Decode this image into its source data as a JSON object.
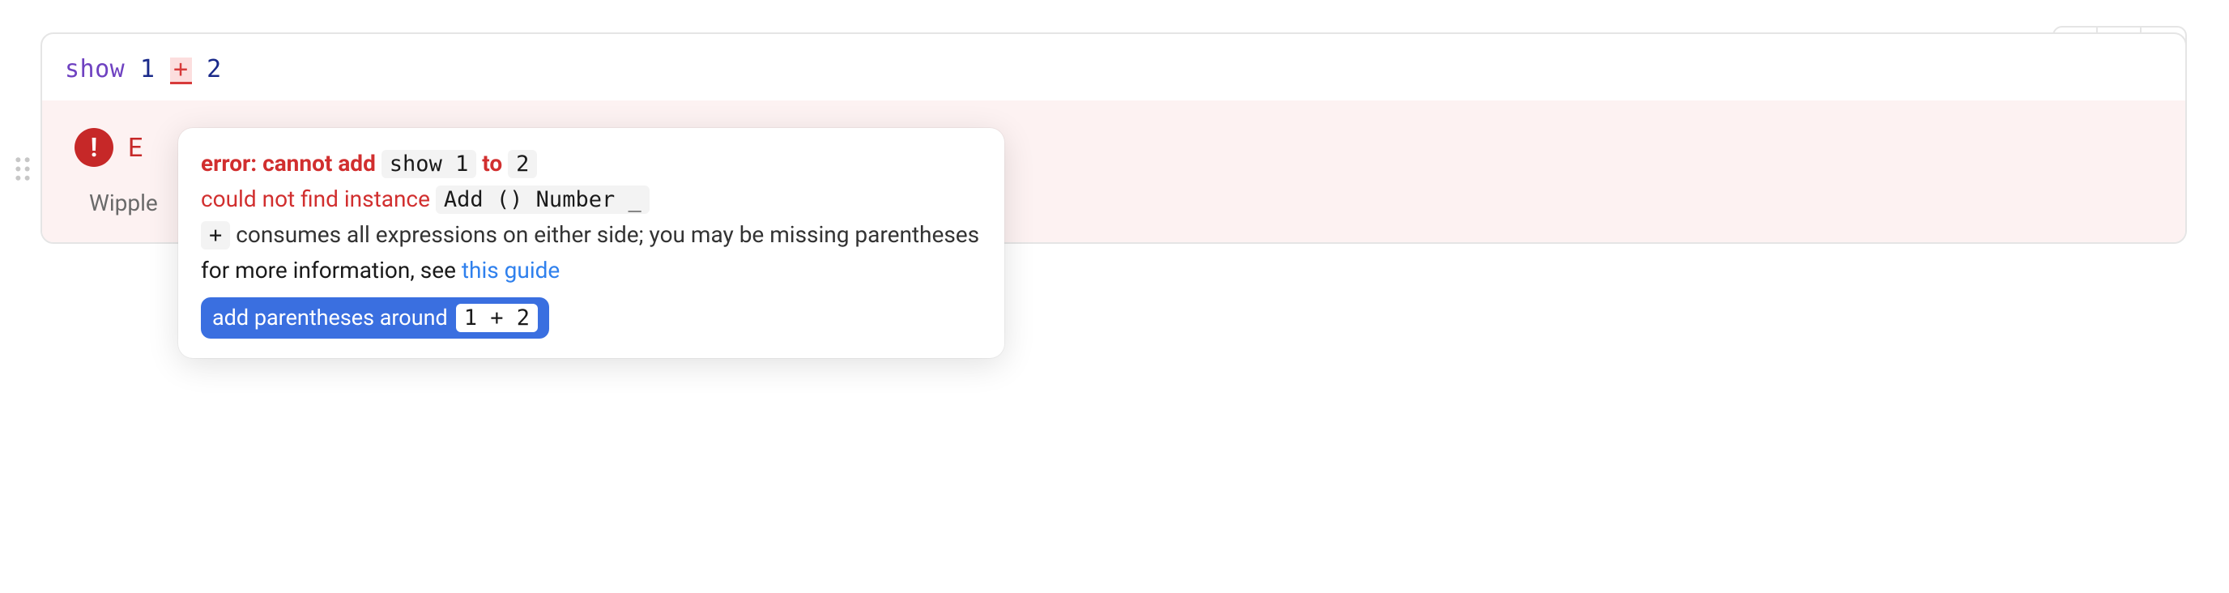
{
  "code": {
    "token_show": "show",
    "token_1": "1",
    "token_plus": "+",
    "token_2": "2"
  },
  "error_panel": {
    "title_visible": "E",
    "subtitle_visible": "Wipple "
  },
  "tooltip": {
    "error_prefix": "error: cannot add ",
    "error_code1": "show 1",
    "error_mid": " to ",
    "error_code2": "2",
    "instance_text": "could not find instance ",
    "instance_code": "Add () Number _",
    "hint_plus": "+",
    "hint_text": " consumes all expressions on either side; you may be missing parentheses",
    "more_info_prefix": "for more information, see ",
    "more_info_link": "this guide",
    "fix_label": "add parentheses around ",
    "fix_code": "1 + 2"
  },
  "icons": {
    "error_bang": "!"
  }
}
